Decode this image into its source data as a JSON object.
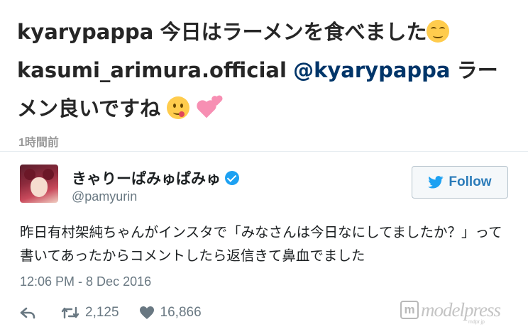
{
  "instagram": {
    "comments": [
      {
        "user": "kyarypappa",
        "mention": "",
        "text": "今日はラーメンを食べました",
        "emoji": "relieved-smile-emoji"
      },
      {
        "user": "kasumi_arimura.official",
        "mention": "@kyarypappa",
        "text": "ラーメン良いですね",
        "emoji": "yum-face-emoji",
        "emoji2": "two-hearts-emoji"
      }
    ],
    "timestamp": "1時間前"
  },
  "tweet": {
    "display_name": "きゃりーぱみゅぱみゅ",
    "verified_icon": "verified-badge-icon",
    "handle": "@pamyurin",
    "follow_label": "Follow",
    "follow_icon": "twitter-bird-icon",
    "text": "昨日有村架純ちゃんがインスタで「みなさんは今日なにしてましたか？」って書いてあったからコメントしたら返信きて鼻血でました",
    "date": "12:06 PM - 8 Dec 2016",
    "actions": {
      "reply_icon": "reply-icon",
      "retweet_icon": "retweet-icon",
      "retweet_count": "2,125",
      "like_icon": "heart-icon",
      "like_count": "16,866"
    },
    "colors": {
      "accent": "#1da1f2",
      "follow_text": "#2b7bb9",
      "meta": "#697882"
    }
  },
  "watermark": {
    "logo_letter": "m",
    "brand": "modelpress",
    "sub": "mdpr.jp"
  }
}
